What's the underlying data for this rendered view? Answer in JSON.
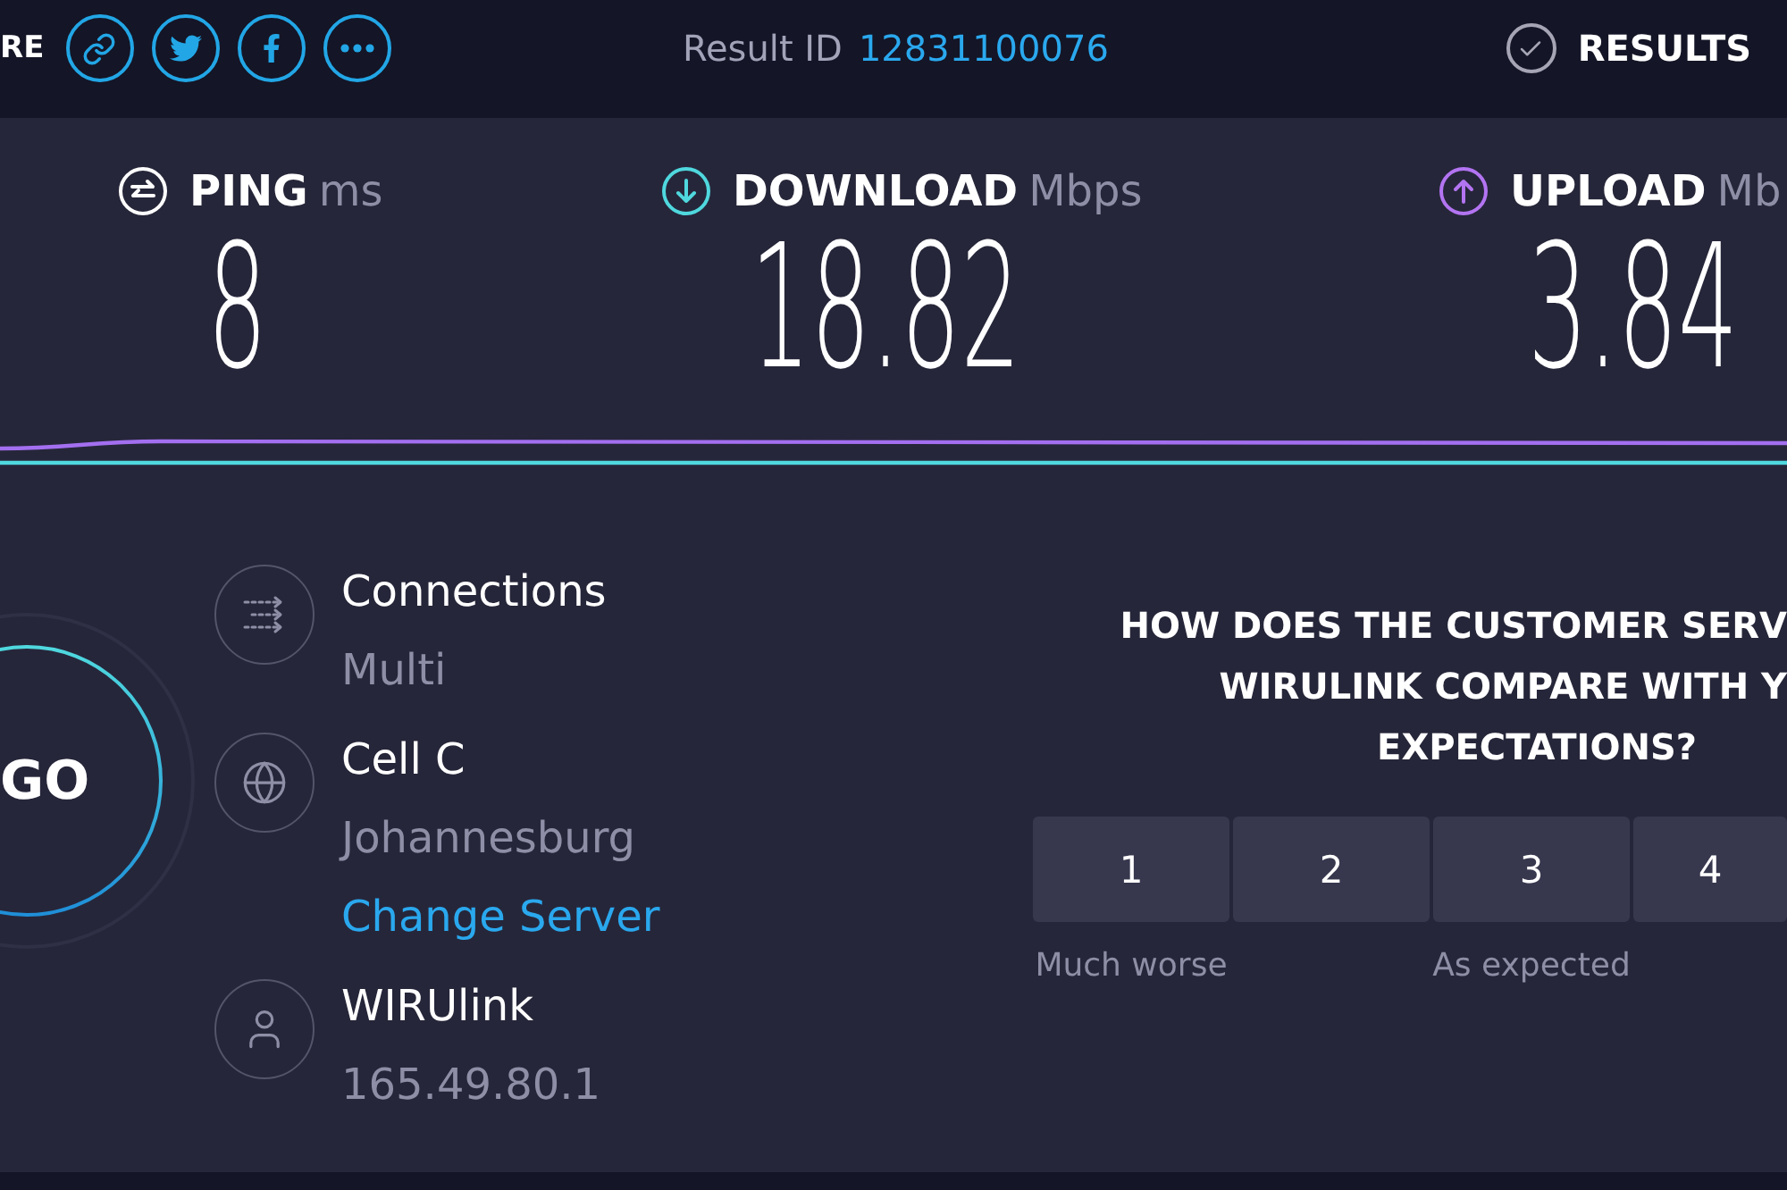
{
  "header": {
    "share_label": "RE",
    "result_id_label": "Result ID",
    "result_id": "12831100076",
    "results_button": "RESULTS"
  },
  "metrics": [
    {
      "kind": "ping",
      "label": "PING",
      "unit": "ms",
      "value": "8"
    },
    {
      "kind": "download",
      "label": "DOWNLOAD",
      "unit": "Mbps",
      "value": "18.82"
    },
    {
      "kind": "upload",
      "label": "UPLOAD",
      "unit": "Mb",
      "value": "3.84"
    }
  ],
  "go_button": "GO",
  "server_info": [
    {
      "kind": "connections",
      "title": "Connections",
      "subtitle": "Multi"
    },
    {
      "kind": "server",
      "title": "Cell C",
      "subtitle": "Johannesburg",
      "link": "Change Server"
    },
    {
      "kind": "provider",
      "title": "WIRUlink",
      "subtitle": "165.49.80.1"
    }
  ],
  "survey": {
    "question_lines": [
      "HOW DOES THE CUSTOMER SERV",
      "WIRULINK COMPARE WITH Y",
      "EXPECTATIONS?"
    ],
    "options": [
      {
        "label": "1",
        "selected": false,
        "caption": "Much worse"
      },
      {
        "label": "2",
        "selected": false
      },
      {
        "label": "3",
        "selected": false,
        "caption": "As expected"
      },
      {
        "label": "4",
        "selected": false
      }
    ]
  }
}
